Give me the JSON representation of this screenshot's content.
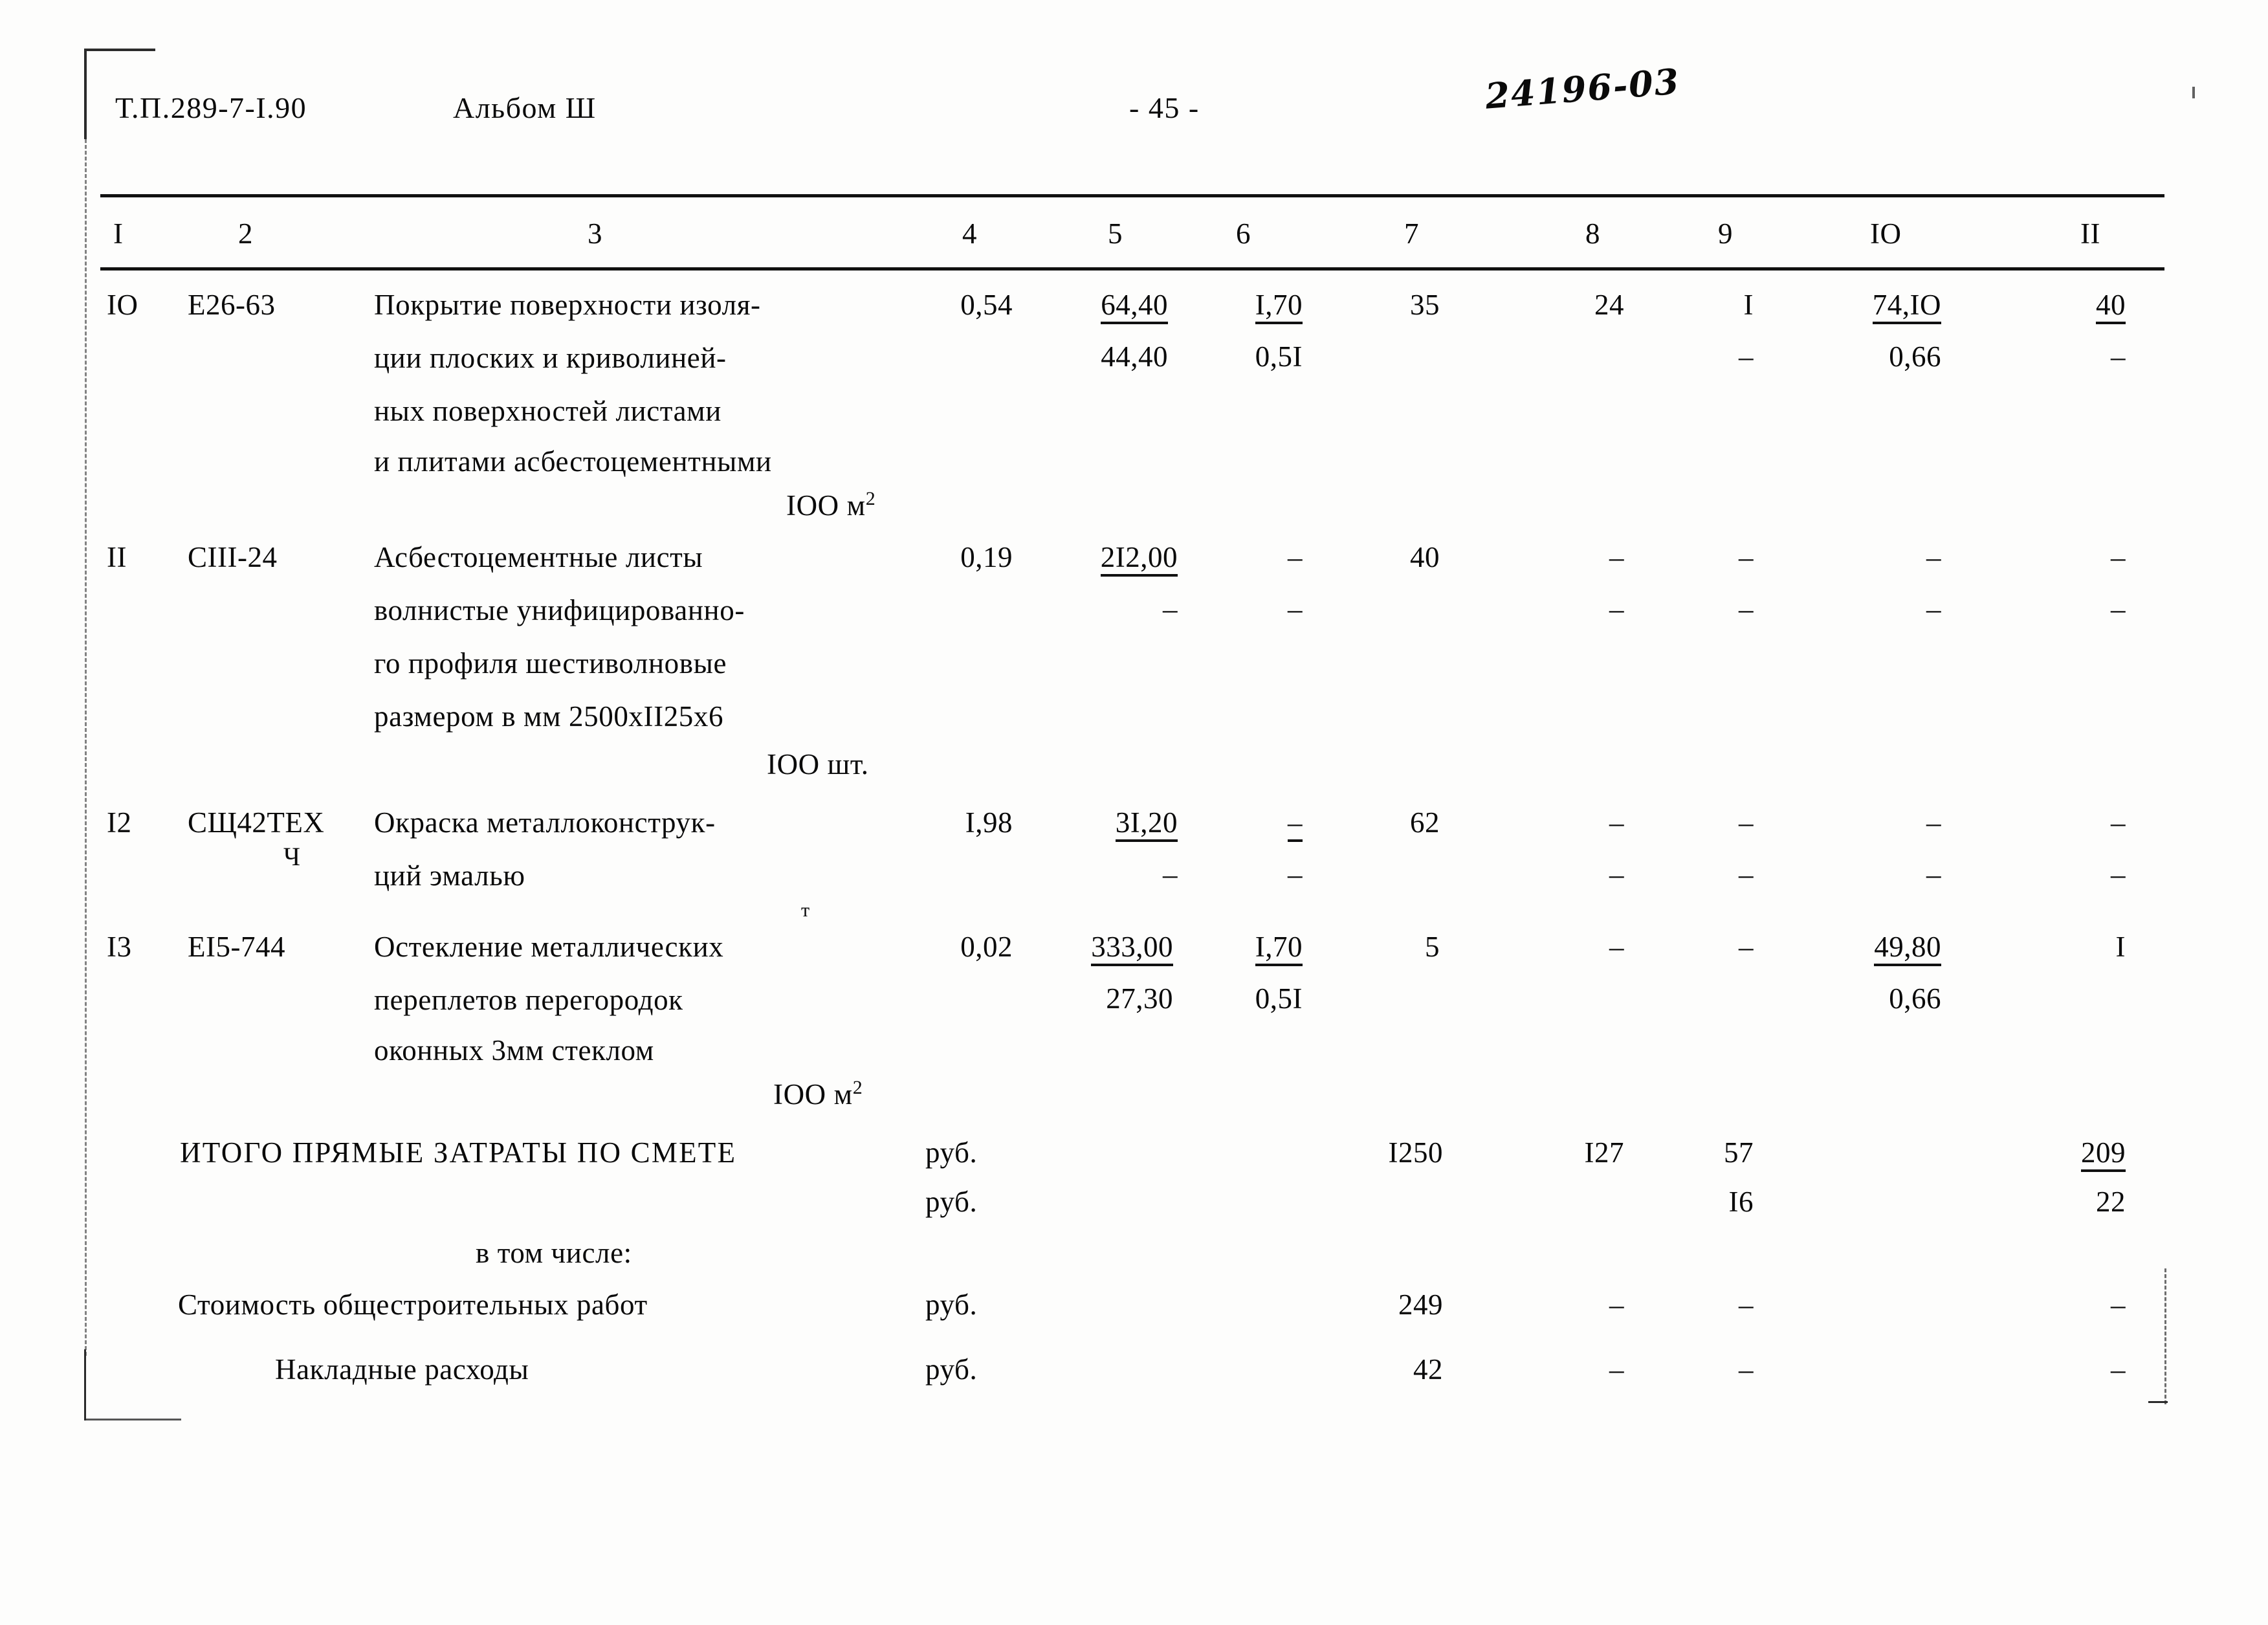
{
  "header": {
    "doc_code": "Т.П.289-7-I.90",
    "album": "Альбом Ш",
    "page_number": "- 45 -",
    "stamp": "24196-03"
  },
  "table": {
    "column_headers": [
      "I",
      "2",
      "3",
      "4",
      "5",
      "6",
      "7",
      "8",
      "9",
      "IO",
      "II"
    ],
    "rows": [
      {
        "no": "IO",
        "code": "Е26-63",
        "description_lines": [
          "Покрытие поверхности изоля-",
          "ции плоских и криволиней-",
          "ных поверхностей листами",
          "и плитами асбестоцементными"
        ],
        "unit": "IOO м",
        "unit_sup": "2",
        "c4": "0,54",
        "c5_top": "64,40",
        "c5_bot": "44,40",
        "c6_top": "I,70",
        "c6_bot": "0,5I",
        "c7_top": "35",
        "c7_bot": "",
        "c8_top": "24",
        "c8_bot": "",
        "c9_top": "I",
        "c9_bot": "–",
        "c10_top": "74,IO",
        "c10_bot": "0,66",
        "c11_top": "40",
        "c11_bot": "–"
      },
      {
        "no": "II",
        "code": "СIII-24",
        "description_lines": [
          "Асбестоцементные листы",
          "волнистые унифицированно-",
          "го профиля шестиволновые",
          "размером в мм 2500хII25х6"
        ],
        "unit": "IOO шт.",
        "unit_sup": "",
        "c4": "0,19",
        "c5_top": "2I2,00",
        "c5_bot": "–",
        "c6_top": "–",
        "c6_bot": "–",
        "c7_top": "40",
        "c7_bot": "",
        "c8_top": "–",
        "c8_bot": "–",
        "c9_top": "–",
        "c9_bot": "–",
        "c10_top": "–",
        "c10_bot": "–",
        "c11_top": "–",
        "c11_bot": "–"
      },
      {
        "no": "I2",
        "code": "СЩ42ТЕХ",
        "code_second_line": "Ч",
        "description_lines": [
          "Окраска металлоконструк-",
          "ций эмалью"
        ],
        "stray_mark": "т",
        "unit": "",
        "unit_sup": "",
        "c4": "I,98",
        "c5_top": "3I,20",
        "c5_bot": "–",
        "c6_top": "–",
        "c6_bot": "–",
        "c7_top": "62",
        "c7_bot": "",
        "c8_top": "–",
        "c8_bot": "–",
        "c9_top": "–",
        "c9_bot": "–",
        "c10_top": "–",
        "c10_bot": "–",
        "c11_top": "–",
        "c11_bot": "–"
      },
      {
        "no": "I3",
        "code": "ЕI5-744",
        "description_lines": [
          "Остекление металлических",
          "переплетов перегородок",
          "оконных 3мм стеклом"
        ],
        "unit": "IOO м",
        "unit_sup": "2",
        "c4": "0,02",
        "c5_top": "333,00",
        "c5_bot": "27,30",
        "c6_top": "I,70",
        "c6_bot": "0,5I",
        "c7_top": "5",
        "c7_bot": "",
        "c8_top": "–",
        "c8_bot": "",
        "c9_top": "–",
        "c9_bot": "",
        "c10_top": "49,80",
        "c10_bot": "0,66",
        "c11_top": "I",
        "c11_bot": ""
      }
    ],
    "totals": [
      {
        "label": "ИТОГО ПРЯМЫЕ ЗАТРАТЫ ПО СМЕТЕ",
        "unit_top": "руб.",
        "unit_bot": "руб.",
        "c7_top": "I250",
        "c7_bot": "",
        "c8_top": "I27",
        "c8_bot": "",
        "c9_top": "57",
        "c9_bot": "I6",
        "c10_top": "",
        "c10_bot": "",
        "c11_top": "209",
        "c11_bot": "22"
      }
    ],
    "subheading": "в том числе:",
    "sub_rows": [
      {
        "label": "Стоимость общестроительных работ",
        "unit": "руб.",
        "c7": "249",
        "c8": "–",
        "c9": "–",
        "c10": "",
        "c11": "–"
      },
      {
        "label": "Накладные расходы",
        "unit": "руб.",
        "c7": "42",
        "c8": "–",
        "c9": "–",
        "c10": "",
        "c11": "–"
      }
    ]
  }
}
